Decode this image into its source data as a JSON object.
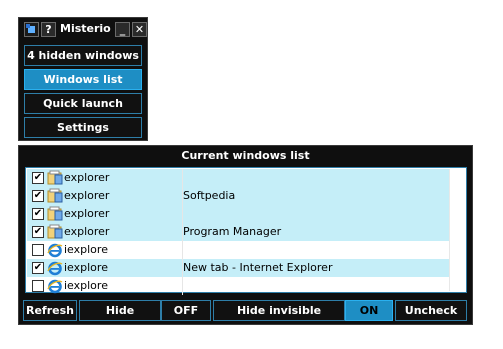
{
  "mini_window": {
    "title": "Misterio",
    "help_label": "?",
    "minimize_label": "_",
    "close_label": "✕",
    "buttons": [
      {
        "label": "4 hidden windows"
      },
      {
        "label": "Windows list"
      },
      {
        "label": "Quick launch"
      },
      {
        "label": "Settings"
      }
    ]
  },
  "main_window": {
    "title": "Current windows list",
    "rows": [
      {
        "checked": "✔",
        "name": "explorer",
        "title": "",
        "icon": "explorer-folder-icon"
      },
      {
        "checked": "✔",
        "name": "explorer",
        "title": "Softpedia",
        "icon": "explorer-folder-icon"
      },
      {
        "checked": "✔",
        "name": "explorer",
        "title": "",
        "icon": "explorer-folder-icon"
      },
      {
        "checked": "✔",
        "name": "explorer",
        "title": "Program Manager",
        "icon": "explorer-folder-icon"
      },
      {
        "checked": "",
        "name": "iexplore",
        "title": "",
        "icon": "internet-explorer-icon"
      },
      {
        "checked": "✔",
        "name": "iexplore",
        "title": "New tab - Internet Explorer",
        "icon": "internet-explorer-icon"
      },
      {
        "checked": "",
        "name": "iexplore",
        "title": "",
        "icon": "internet-explorer-icon"
      }
    ],
    "toolbar": {
      "refresh": "Refresh",
      "hide_explorer": "Hide explorer",
      "hide_explorer_state": "OFF",
      "hide_invisible": "Hide invisible windows",
      "hide_invisible_state": "ON",
      "uncheck_all": "Uncheck all"
    }
  },
  "colors": {
    "accent": "#1e8ec4",
    "row_highlight": "#c5eef8",
    "window_bg": "#0f0f0f"
  }
}
